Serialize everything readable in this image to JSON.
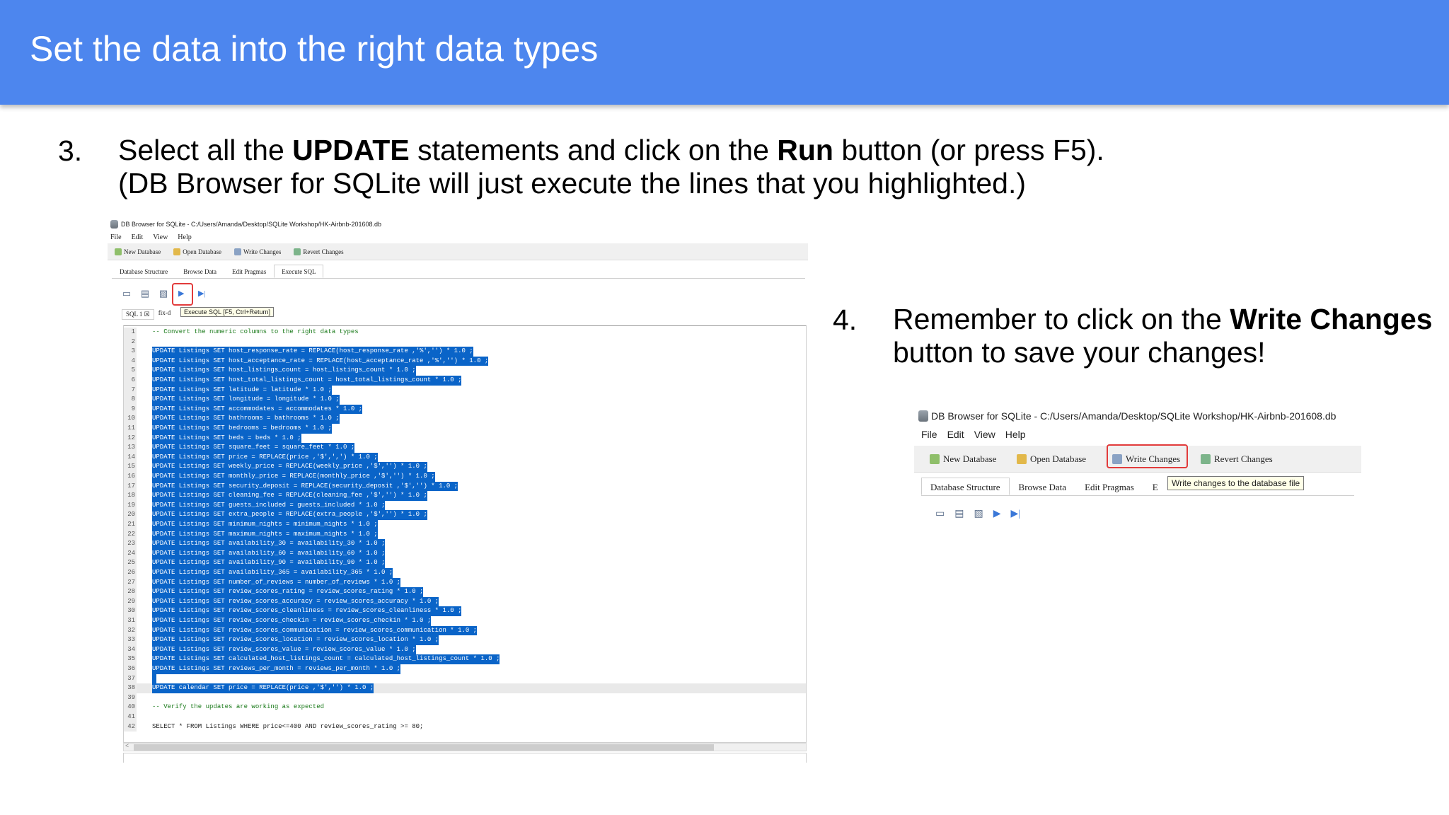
{
  "slide": {
    "title": "Set the data into the right data types",
    "step3": {
      "num": "3.",
      "line1_a": "Select all the ",
      "line1_b": "UPDATE",
      "line1_c": " statements and click on the ",
      "line1_d": "Run",
      "line1_e": " button (or press F5).",
      "line2": "(DB Browser for SQLite will just execute the lines that you highlighted.)"
    },
    "step4": {
      "num": "4.",
      "line1_a": "Remember to click on the ",
      "line1_b": "Write Changes",
      "line2": "button to save your changes!"
    }
  },
  "shot1": {
    "window_title": "DB Browser for SQLite - C:/Users/Amanda/Desktop/SQLite Workshop/HK-Airbnb-201608.db",
    "menu": [
      "File",
      "Edit",
      "View",
      "Help"
    ],
    "toolbar": [
      "New Database",
      "Open Database",
      "Write Changes",
      "Revert Changes"
    ],
    "tabs": [
      "Database Structure",
      "Browse Data",
      "Edit Pragmas",
      "Execute SQL"
    ],
    "sql_tab": "SQL 1",
    "sql_tab_close": "☒",
    "sql_tab2": "fix-d",
    "tooltip": "Execute SQL [F5, Ctrl+Return]",
    "scroll_left": "<",
    "lines": [
      {
        "n": "1",
        "t": "-- Convert the numeric columns to the right data types",
        "k": "comment"
      },
      {
        "n": "2",
        "t": "",
        "k": "plain"
      },
      {
        "n": "3",
        "t": "UPDATE Listings SET host_response_rate = REPLACE(host_response_rate ,'%','') * 1.0 ;",
        "k": "sel"
      },
      {
        "n": "4",
        "t": "UPDATE Listings SET host_acceptance_rate = REPLACE(host_acceptance_rate ,'%','') * 1.0 ;",
        "k": "sel"
      },
      {
        "n": "5",
        "t": "UPDATE Listings SET host_listings_count = host_listings_count * 1.0 ;",
        "k": "sel"
      },
      {
        "n": "6",
        "t": "UPDATE Listings SET host_total_listings_count = host_total_listings_count * 1.0 ;",
        "k": "sel"
      },
      {
        "n": "7",
        "t": "UPDATE Listings SET latitude = latitude * 1.0 ;",
        "k": "sel"
      },
      {
        "n": "8",
        "t": "UPDATE Listings SET longitude = longitude * 1.0 ;",
        "k": "sel"
      },
      {
        "n": "9",
        "t": "UPDATE Listings SET accommodates = accommodates * 1.0 ;",
        "k": "sel"
      },
      {
        "n": "10",
        "t": "UPDATE Listings SET bathrooms = bathrooms * 1.0 ;",
        "k": "sel"
      },
      {
        "n": "11",
        "t": "UPDATE Listings SET bedrooms = bedrooms * 1.0 ;",
        "k": "sel"
      },
      {
        "n": "12",
        "t": "UPDATE Listings SET beds = beds * 1.0 ;",
        "k": "sel"
      },
      {
        "n": "13",
        "t": "UPDATE Listings SET square_feet = square_feet * 1.0 ;",
        "k": "sel"
      },
      {
        "n": "14",
        "t": "UPDATE Listings SET price = REPLACE(price ,'$',',') * 1.0 ;",
        "k": "sel"
      },
      {
        "n": "15",
        "t": "UPDATE Listings SET weekly_price = REPLACE(weekly_price ,'$','') * 1.0 ;",
        "k": "sel"
      },
      {
        "n": "16",
        "t": "UPDATE Listings SET monthly_price = REPLACE(monthly_price ,'$','') * 1.0 ;",
        "k": "sel"
      },
      {
        "n": "17",
        "t": "UPDATE Listings SET security_deposit = REPLACE(security_deposit ,'$','') * 1.0 ;",
        "k": "sel"
      },
      {
        "n": "18",
        "t": "UPDATE Listings SET cleaning_fee = REPLACE(cleaning_fee ,'$','') * 1.0 ;",
        "k": "sel"
      },
      {
        "n": "19",
        "t": "UPDATE Listings SET guests_included = guests_included * 1.0 ;",
        "k": "sel"
      },
      {
        "n": "20",
        "t": "UPDATE Listings SET extra_people = REPLACE(extra_people ,'$','') * 1.0 ;",
        "k": "sel"
      },
      {
        "n": "21",
        "t": "UPDATE Listings SET minimum_nights = minimum_nights * 1.0 ;",
        "k": "sel"
      },
      {
        "n": "22",
        "t": "UPDATE Listings SET maximum_nights = maximum_nights * 1.0 ;",
        "k": "sel"
      },
      {
        "n": "23",
        "t": "UPDATE Listings SET availability_30 = availability_30 * 1.0 ;",
        "k": "sel"
      },
      {
        "n": "24",
        "t": "UPDATE Listings SET availability_60 = availability_60 * 1.0 ;",
        "k": "sel"
      },
      {
        "n": "25",
        "t": "UPDATE Listings SET availability_90 = availability_90 * 1.0 ;",
        "k": "sel"
      },
      {
        "n": "26",
        "t": "UPDATE Listings SET availability_365 = availability_365 * 1.0 ;",
        "k": "sel"
      },
      {
        "n": "27",
        "t": "UPDATE Listings SET number_of_reviews = number_of_reviews * 1.0 ;",
        "k": "sel"
      },
      {
        "n": "28",
        "t": "UPDATE Listings SET review_scores_rating = review_scores_rating * 1.0 ;",
        "k": "sel"
      },
      {
        "n": "29",
        "t": "UPDATE Listings SET review_scores_accuracy = review_scores_accuracy * 1.0 ;",
        "k": "sel"
      },
      {
        "n": "30",
        "t": "UPDATE Listings SET review_scores_cleanliness = review_scores_cleanliness * 1.0 ;",
        "k": "sel"
      },
      {
        "n": "31",
        "t": "UPDATE Listings SET review_scores_checkin = review_scores_checkin * 1.0 ;",
        "k": "sel"
      },
      {
        "n": "32",
        "t": "UPDATE Listings SET review_scores_communication = review_scores_communication * 1.0 ;",
        "k": "sel"
      },
      {
        "n": "33",
        "t": "UPDATE Listings SET review_scores_location = review_scores_location * 1.0 ;",
        "k": "sel"
      },
      {
        "n": "34",
        "t": "UPDATE Listings SET review_scores_value = review_scores_value * 1.0 ;",
        "k": "sel"
      },
      {
        "n": "35",
        "t": "UPDATE Listings SET calculated_host_listings_count = calculated_host_listings_count * 1.0 ;",
        "k": "sel"
      },
      {
        "n": "36",
        "t": "UPDATE Listings SET reviews_per_month = reviews_per_month * 1.0 ;",
        "k": "sel"
      },
      {
        "n": "37",
        "t": "",
        "k": "selblank"
      },
      {
        "n": "38",
        "t": "UPDATE calendar SET price = REPLACE(price ,'$','') * 1.0 ;",
        "k": "selband"
      },
      {
        "n": "39",
        "t": "",
        "k": "plain"
      },
      {
        "n": "40",
        "t": "-- Verify the updates are working as expected",
        "k": "comment"
      },
      {
        "n": "41",
        "t": "",
        "k": "plain"
      },
      {
        "n": "42",
        "t": "SELECT * FROM Listings WHERE price<=400 AND review_scores_rating >= 80;",
        "k": "plain"
      }
    ]
  },
  "shot2": {
    "window_title": "DB Browser for SQLite - C:/Users/Amanda/Desktop/SQLite Workshop/HK-Airbnb-201608.db",
    "menu": [
      "File",
      "Edit",
      "View",
      "Help"
    ],
    "toolbar": [
      "New Database",
      "Open Database",
      "Write Changes",
      "Revert Changes"
    ],
    "tabs": [
      "Database Structure",
      "Browse Data",
      "Edit Pragmas",
      "E"
    ],
    "tooltip": "Write changes to the database file"
  }
}
